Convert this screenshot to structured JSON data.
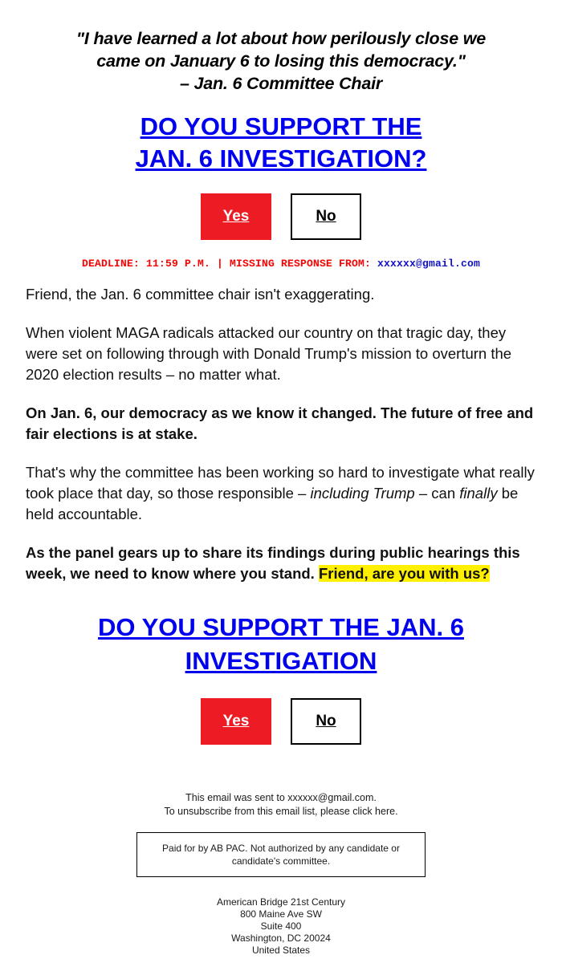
{
  "quote": {
    "line1": "\"I have learned a lot about how perilously close we",
    "line2": "came on January 6 to losing this democracy.\"",
    "attribution": "– Jan. 6 Committee Chair"
  },
  "headline_1": {
    "line1": "DO YOU SUPPORT THE",
    "line2": "JAN. 6 INVESTIGATION?"
  },
  "headline_2": {
    "line1": "DO YOU SUPPORT THE JAN. 6",
    "line2": "INVESTIGATION"
  },
  "buttons": {
    "yes_label": "Yes",
    "no_label": "No",
    "yes_bg": "#ED1C24",
    "yes_color": "#FFFFFF",
    "no_border": "#000000"
  },
  "deadline": {
    "prefix": "DEADLINE: 11:59 P.M.  |  MISSING RESPONSE FROM: ",
    "email": "xxxxxx@gmail.com",
    "color": "#FF0000",
    "email_color": "#1111CC"
  },
  "body": {
    "p1": "Friend, the Jan. 6 committee chair isn't exaggerating.",
    "p2": "When violent MAGA radicals attacked our country on that tragic day, they were set on following through with Donald Trump's mission to overturn the 2020 election results – no matter what.",
    "p3": "On Jan. 6, our democracy as we know it changed. The future of free and fair elections is at stake.",
    "p4_a": "That's why the committee has been working so hard to investigate what really took place that day, so those responsible – ",
    "p4_em1": "including Trump",
    "p4_b": " – can ",
    "p4_em2": "finally",
    "p4_c": " be held accountable.",
    "p5_a": "As the panel gears up to share its findings during public hearings this week, we need to know where you stand. ",
    "p5_highlight": "Friend, are you with us?",
    "highlight_color": "#FFF000"
  },
  "footer": {
    "sent_to": "This email was sent to xxxxxx@gmail.com.",
    "unsubscribe": "To unsubscribe from this email list, please click here.",
    "disclaimer": "Paid for by AB PAC. Not authorized by any candidate or candidate's committee.",
    "address": [
      "American Bridge 21st Century",
      "800 Maine Ave SW",
      "Suite 400",
      "Washington, DC 20024",
      "United States"
    ]
  }
}
